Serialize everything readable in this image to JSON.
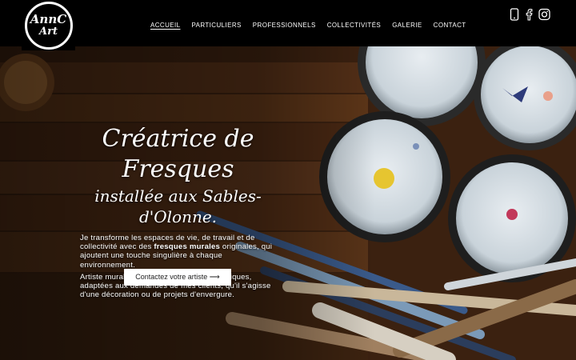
{
  "logo": {
    "line1": "AnnC",
    "line2": "Art"
  },
  "nav": {
    "items": [
      {
        "label": "Accueil",
        "active": true
      },
      {
        "label": "Particuliers"
      },
      {
        "label": "Professionnels"
      },
      {
        "label": "Collectivités"
      },
      {
        "label": "Galerie"
      },
      {
        "label": "Contact"
      }
    ]
  },
  "social": {
    "icons": [
      "phone-icon",
      "facebook-icon",
      "instagram-icon"
    ]
  },
  "hero": {
    "title_line1": "Créatrice de",
    "title_line2": "Fresques",
    "subtitle_line1": "installée aux Sables-",
    "subtitle_line2": "d'Olonne.",
    "para1_part1": "Je transforme les espaces de vie, de travail et de collectivité avec des ",
    "para1_bold": "fresques murales",
    "para1_part2": " originales, qui ajoutent une touche singulière à chaque environnement.",
    "para2": "Artiste muraliste, je réalise des œuvres uniques, adaptées aux demandes de mes clients, qu'il s'agisse d'une décoration ou de projets d'envergure.",
    "cta_label": "Contactez votre artiste ⟶"
  },
  "colors": {
    "header_bg": "#000000",
    "text": "#ffffff",
    "cta_bg": "#ffffff",
    "cta_text": "#222222"
  }
}
